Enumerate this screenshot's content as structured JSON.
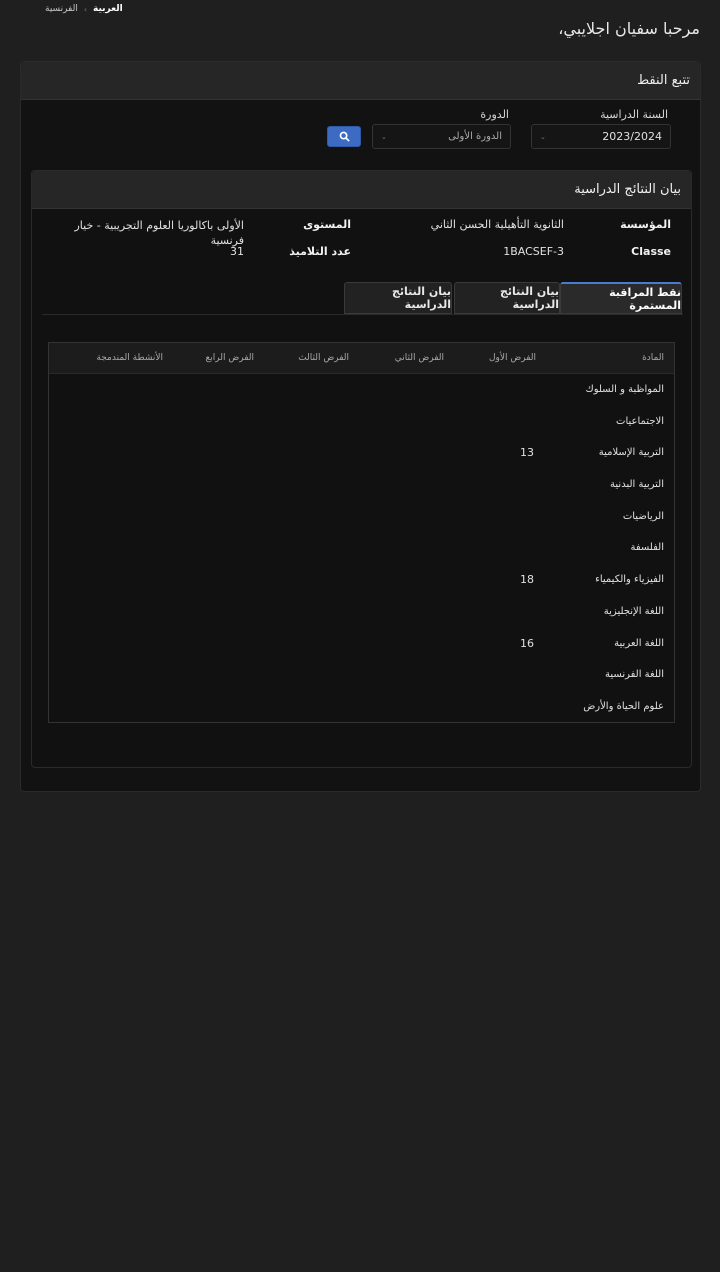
{
  "languages": {
    "arabic": "العربية",
    "french": "الفرنسية"
  },
  "welcome": "مرحبا سفيان اجلايبي،",
  "panel_title": "تتبع النقط",
  "filters": {
    "year_label": "السنة الدراسية",
    "year_value": "2023/2024",
    "session_label": "الدورة",
    "session_value": "الدورة الأولى"
  },
  "results": {
    "title": "بيان النتائج الدراسية",
    "institution_label": "المؤسسة",
    "institution_value": "الثانوية التأهيلية الحسن الثاني",
    "level_label": "المستوى",
    "level_value": "الأولى باكالوريا العلوم التجريبية - خيار فرنسية",
    "class_label": "Classe",
    "class_value": "1BACSEF-3",
    "students_label": "عدد التلاميذ",
    "students_value": "31"
  },
  "tabs": [
    "نقط المراقبة المستمرة",
    "بيان النتائج الدراسية",
    "بيان النتائج الدراسية"
  ],
  "table": {
    "headers": [
      "المادة",
      "الفرض الأول",
      "الفرض الثاني",
      "الفرض الثالث",
      "الفرض الرابع",
      "الأنشطة المندمجة"
    ],
    "rows": [
      {
        "subject": "المواظبة و السلوك",
        "g1": ""
      },
      {
        "subject": "الاجتماعيات",
        "g1": ""
      },
      {
        "subject": "التربية الإسلامية",
        "g1": "13"
      },
      {
        "subject": "التربية البدنية",
        "g1": ""
      },
      {
        "subject": "الرياضيات",
        "g1": ""
      },
      {
        "subject": "الفلسفة",
        "g1": ""
      },
      {
        "subject": "الفيزياء والكيمياء",
        "g1": "18"
      },
      {
        "subject": "اللغة الإنجليزية",
        "g1": ""
      },
      {
        "subject": "اللغة العربية",
        "g1": "16"
      },
      {
        "subject": "اللغة الفرنسية",
        "g1": ""
      },
      {
        "subject": "علوم الحياة والأرض",
        "g1": ""
      }
    ]
  },
  "colors": {
    "accent": "#3d6bc4",
    "background": "#1f1f1f"
  }
}
